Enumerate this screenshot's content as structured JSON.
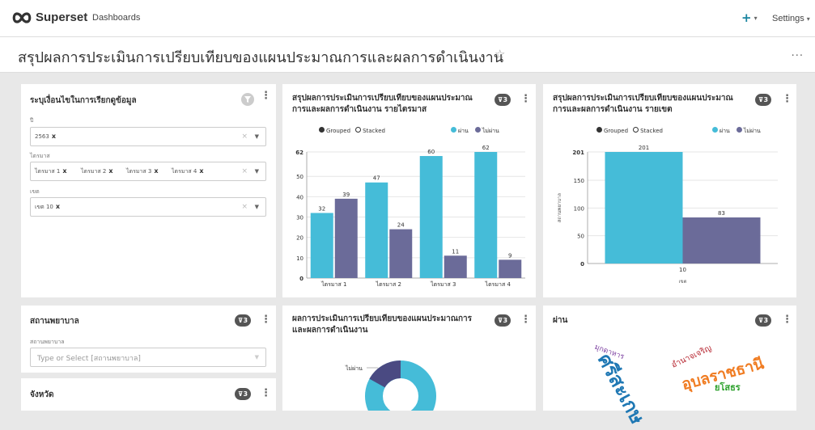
{
  "app": {
    "brand": "Superset",
    "nav_dashboards": "Dashboards",
    "nav_plus": "+",
    "nav_settings": "Settings"
  },
  "page": {
    "title": "สรุปผลการประเมินการเปรียบเทียบของแผนประมาณการและผลการดำเนินงาน",
    "more": "..."
  },
  "colors": {
    "accent": "#1a85a0",
    "series_pass": "#45bcd8",
    "series_fail": "#6b6b99",
    "badge": "#555555"
  },
  "filter_card": {
    "title": "ระบุเงื่อนไขในการเรียกดูข้อมูล",
    "year": {
      "label": "ปี",
      "tags": [
        "2563"
      ]
    },
    "quarter": {
      "label": "ไตรมาส",
      "tags": [
        "ไตรมาส 1",
        "ไตรมาส 2",
        "ไตรมาส 3",
        "ไตรมาส 4"
      ]
    },
    "zone": {
      "label": "เขต",
      "tags": [
        "เขต 10"
      ]
    },
    "clear": "×",
    "arrow": "▼",
    "tag_x": "x"
  },
  "quarter_chart": {
    "title_l1": "สรุปผลการประเมินการเปรียบเทียบของแผนประมาณ",
    "title_l2": "การและผลการดำเนินงาน รายไตรมาส",
    "badge": "3",
    "legend_grouped": "Grouped",
    "legend_stacked": "Stacked",
    "legend_pass": "ผ่าน",
    "legend_fail": "ไม่ผ่าน"
  },
  "zone_chart": {
    "title_l1": "สรุปผลการประเมินการเปรียบเทียบของแผนประมาณ",
    "title_l2": "การและผลการดำเนินงาน รายเขต",
    "badge": "3",
    "legend_grouped": "Grouped",
    "legend_stacked": "Stacked",
    "legend_pass": "ผ่าน",
    "legend_fail": "ไม่ผ่าน"
  },
  "chart_data": [
    {
      "type": "bar",
      "categories": [
        "ไตรมาส 1",
        "ไตรมาส 2",
        "ไตรมาส 3",
        "ไตรมาส 4"
      ],
      "series": [
        {
          "name": "ผ่าน",
          "values": [
            32,
            47,
            60,
            62
          ]
        },
        {
          "name": "ไม่ผ่าน",
          "values": [
            39,
            24,
            11,
            9
          ]
        }
      ],
      "y_ticks": [
        0,
        10,
        20,
        30,
        40,
        50,
        62
      ],
      "ylim": [
        0,
        62
      ]
    },
    {
      "type": "bar",
      "categories": [
        "10"
      ],
      "series": [
        {
          "name": "ผ่าน",
          "values": [
            201
          ]
        },
        {
          "name": "ไม่ผ่าน",
          "values": [
            83
          ]
        }
      ],
      "xlabel": "เขต",
      "ylabel": "สถานพยาบาล",
      "y_ticks": [
        0,
        50,
        100,
        150,
        201
      ],
      "ylim": [
        0,
        201
      ]
    }
  ],
  "hospital_card": {
    "title": "สถานพยาบาล",
    "badge": "3",
    "field_label": "สถานพยาบาล",
    "placeholder": "Type or Select [สถานพยาบาล]",
    "arrow": "▼"
  },
  "province_card": {
    "title": "จังหวัด",
    "badge": "3"
  },
  "donut_card": {
    "title_l1": "ผลการประเมินการเปรียบเทียบของแผนประมาณการ",
    "title_l2": "และผลการดำเนินงาน",
    "badge": "3",
    "label_fail": "ไม่ผ่าน"
  },
  "cloud_card": {
    "title": "ผ่าน",
    "badge": "3",
    "words": [
      "ศรีสะเกษ",
      "มุกดาหาร",
      "อำนาจเจริญ",
      "อุบลราชธานี",
      "ยโสธร"
    ]
  }
}
